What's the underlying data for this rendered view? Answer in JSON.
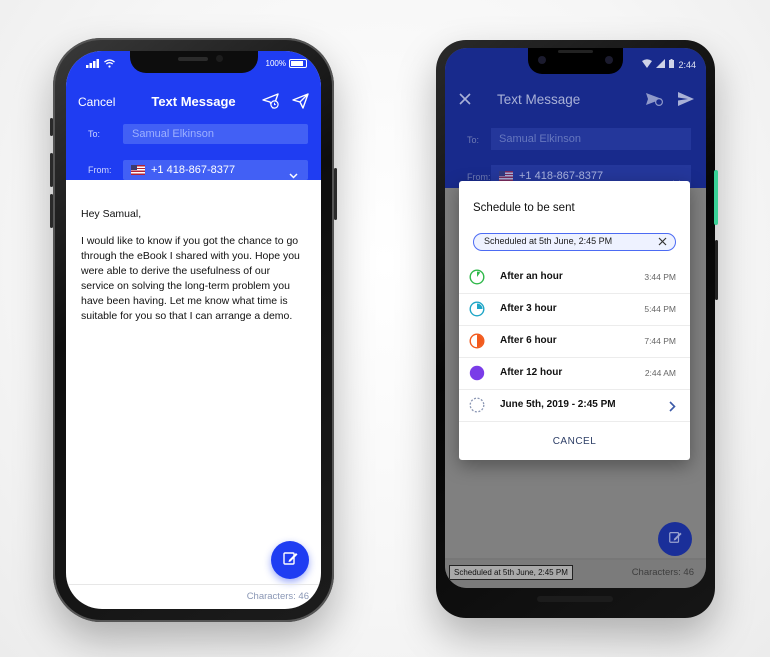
{
  "iphone": {
    "status": {
      "battery": "100%"
    },
    "header": {
      "cancel": "Cancel",
      "title": "Text Message"
    },
    "to": {
      "label": "To:",
      "value": "Samual Elkinson"
    },
    "from": {
      "label": "From:",
      "value": "+1 418-867-8377"
    },
    "message": {
      "greeting": "Hey Samual,",
      "body": "I would like to know if you got the chance to go through the eBook I shared with you. Hope you were able to derive the usefulness of our service on solving the long-term problem you have been having. Let me know what time is suitable for you so that I can arrange a demo."
    },
    "footer": {
      "characters": "Characters: 46"
    }
  },
  "pixel": {
    "status": {
      "time": "2:44"
    },
    "header": {
      "title": "Text Message"
    },
    "to": {
      "label": "To:",
      "value": "Samual Elkinson"
    },
    "from": {
      "label": "From:",
      "value": "+1 418-867-8377"
    },
    "dialog": {
      "title": "Schedule to be sent",
      "chip": "Scheduled at 5th June, 2:45 PM",
      "options": [
        {
          "label": "After an hour",
          "time": "3:44 PM",
          "color": "#2fb84a"
        },
        {
          "label": "After 3 hour",
          "time": "5:44 PM",
          "color": "#1fa6c7"
        },
        {
          "label": "After 6 hour",
          "time": "7:44 PM",
          "color": "#f25a1d"
        },
        {
          "label": "After 12 hour",
          "time": "2:44 AM",
          "color": "#7a3ce8"
        },
        {
          "label": "June 5th, 2019 - 2:45 PM",
          "time": "",
          "color": "#8a96b3"
        }
      ],
      "cancel": "CANCEL"
    },
    "footer": {
      "scheduled": "Scheduled at 5th June, 2:45 PM",
      "characters": "Characters: 46"
    }
  },
  "colors": {
    "primary": "#1f3df2",
    "header_dim": "#182a8c"
  }
}
